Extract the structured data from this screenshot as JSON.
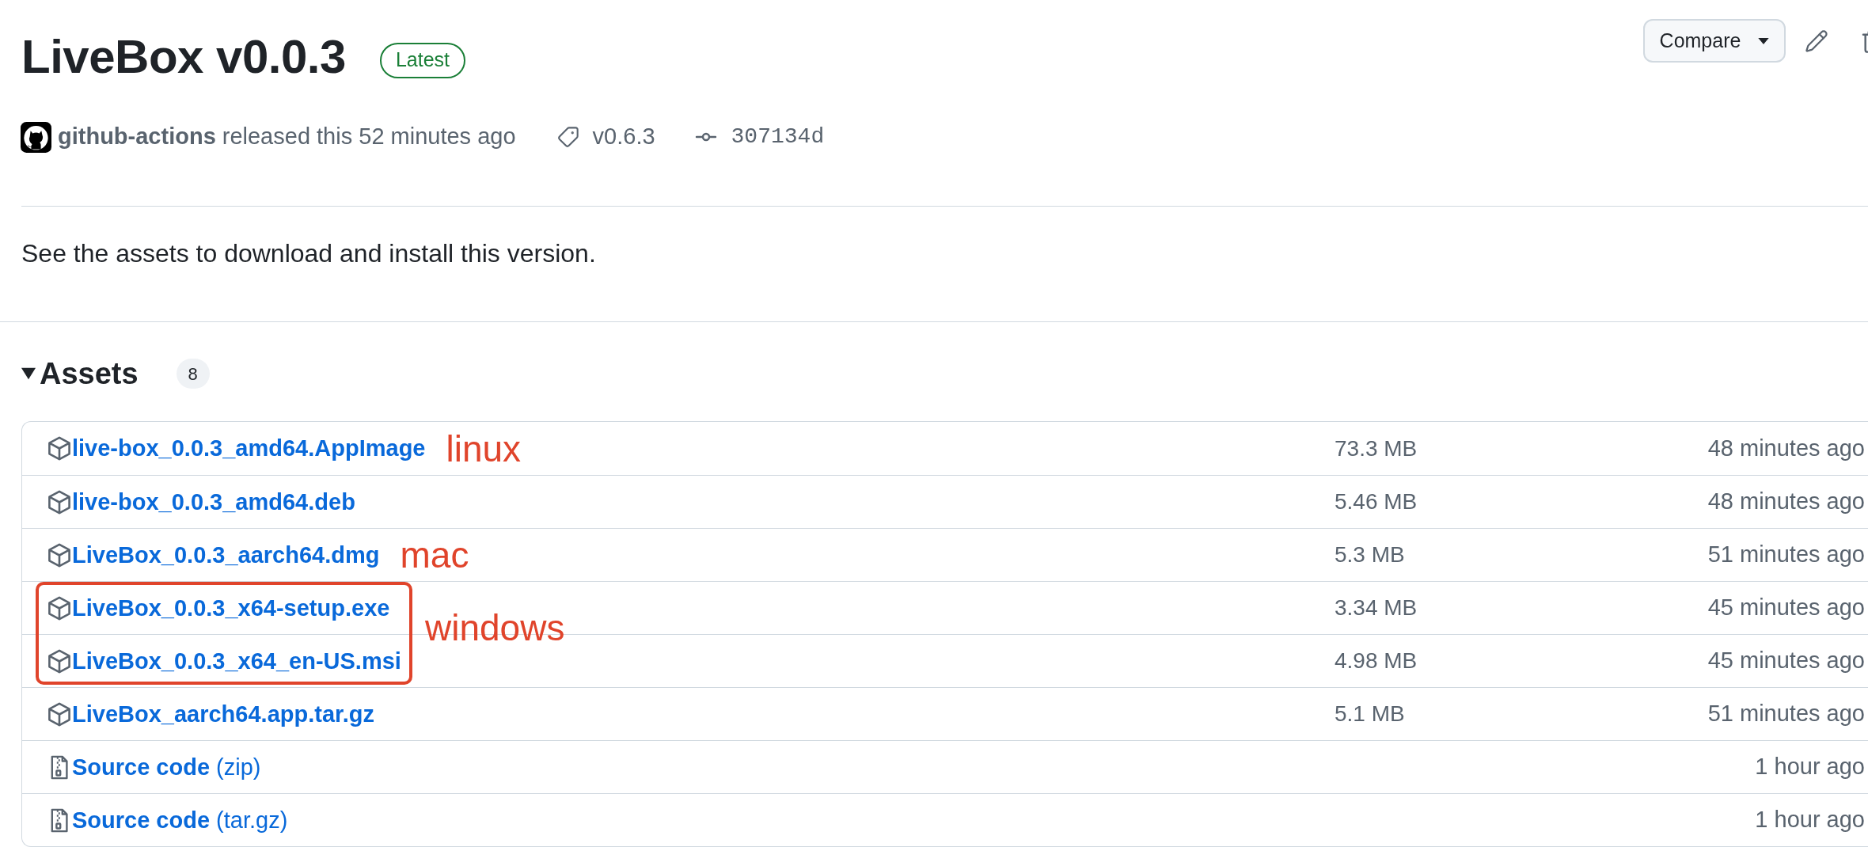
{
  "release": {
    "title": "LiveBox v0.0.3",
    "badge": "Latest",
    "author": "github-actions",
    "released": "released this 52 minutes ago",
    "tag": "v0.6.3",
    "commit": "307134d"
  },
  "actions": {
    "compare": "Compare"
  },
  "description": "See the assets to download and install this version.",
  "assets": {
    "title": "Assets",
    "count": "8",
    "expanded": true,
    "items": [
      {
        "kind": "package",
        "name": "live-box_0.0.3_amd64.AppImage",
        "size": "73.3 MB",
        "time": "48 minutes ago",
        "annotation": "linux",
        "boxed": false
      },
      {
        "kind": "package",
        "name": "live-box_0.0.3_amd64.deb",
        "size": "5.46 MB",
        "time": "48 minutes ago",
        "boxed": false
      },
      {
        "kind": "package",
        "name": "LiveBox_0.0.3_aarch64.dmg",
        "size": "5.3 MB",
        "time": "51 minutes ago",
        "annotation": "mac",
        "boxed": false
      },
      {
        "kind": "package",
        "name": "LiveBox_0.0.3_x64-setup.exe",
        "size": "3.34 MB",
        "time": "45 minutes ago",
        "annotation": "windows",
        "boxed": true
      },
      {
        "kind": "package",
        "name": "LiveBox_0.0.3_x64_en-US.msi",
        "size": "4.98 MB",
        "time": "45 minutes ago",
        "boxed": true
      },
      {
        "kind": "package",
        "name": "LiveBox_aarch64.app.tar.gz",
        "size": "5.1 MB",
        "time": "51 minutes ago",
        "boxed": false
      },
      {
        "kind": "source",
        "name": "**Source code** (zip)",
        "time": "1 hour ago",
        "boxed": false
      },
      {
        "kind": "source",
        "name": "**Source code** (tar.gz)",
        "time": "1 hour ago",
        "boxed": false
      }
    ]
  }
}
